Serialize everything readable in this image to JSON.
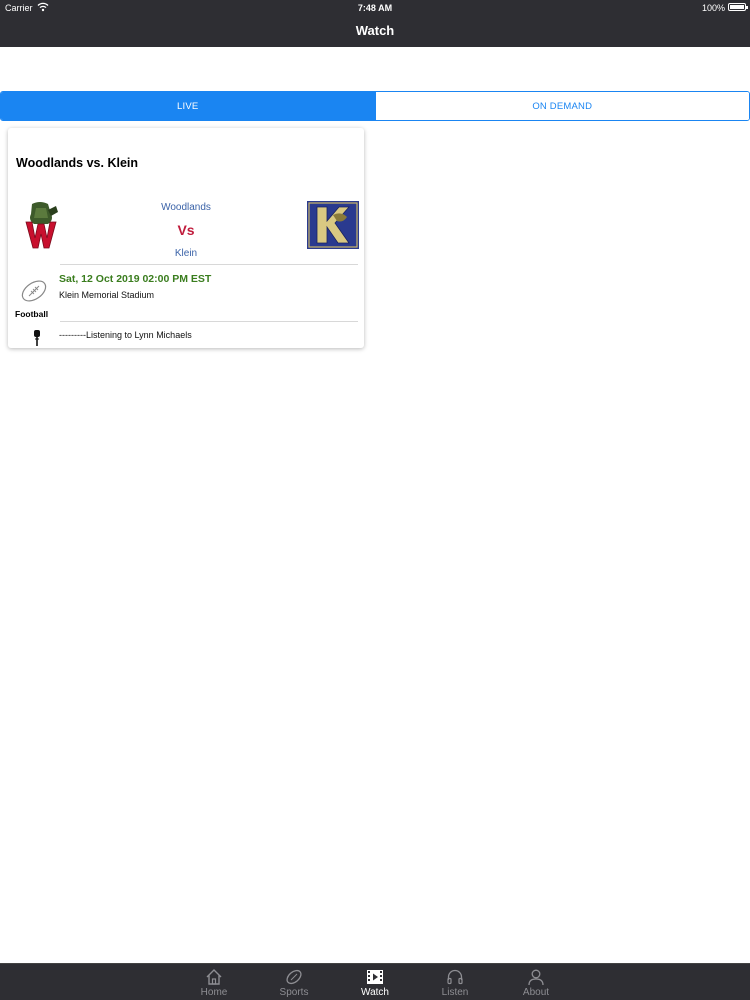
{
  "status_bar": {
    "carrier": "Carrier",
    "time": "7:48 AM",
    "battery": "100%"
  },
  "nav": {
    "title": "Watch"
  },
  "segment": {
    "live_label": "LIVE",
    "on_demand_label": "ON DEMAND",
    "selected": "LIVE"
  },
  "game_card": {
    "title": "Woodlands vs. Klein",
    "home_team": "Woodlands",
    "vs": "Vs",
    "away_team": "Klein",
    "datetime": "Sat, 12 Oct 2019 02:00 PM EST",
    "venue": "Klein Memorial Stadium",
    "sport": "Football",
    "listening": "---------Listening to Lynn Michaels",
    "home_logo_icon": "woodlands-w-logo-icon",
    "away_logo_icon": "klein-k-logo-icon"
  },
  "tabbar": {
    "items": [
      {
        "label": "Home",
        "icon": "home-icon"
      },
      {
        "label": "Sports",
        "icon": "football-icon"
      },
      {
        "label": "Watch",
        "icon": "video-icon"
      },
      {
        "label": "Listen",
        "icon": "headphones-icon"
      },
      {
        "label": "About",
        "icon": "person-icon"
      }
    ],
    "active": "Watch"
  },
  "colors": {
    "bar_bg": "#2e2e33",
    "accent_blue": "#1a85f2",
    "team_blue": "#3b63a8",
    "vs_red": "#c01c3c",
    "date_green": "#3a7d1e"
  }
}
